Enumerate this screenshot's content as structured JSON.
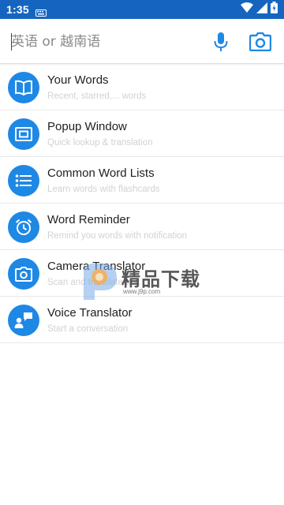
{
  "status": {
    "time": "1:35"
  },
  "search": {
    "placeholder": "英语 or 越南语"
  },
  "colors": {
    "accent": "#1e88e5",
    "statusbar": "#1565c0"
  },
  "menu": [
    {
      "icon": "book-icon",
      "title": "Your Words",
      "subtitle": "Recent, starred,... words"
    },
    {
      "icon": "popup-window-icon",
      "title": "Popup Window",
      "subtitle": "Quick lookup & translation"
    },
    {
      "icon": "list-icon",
      "title": "Common Word Lists",
      "subtitle": "Learn words with flashcards"
    },
    {
      "icon": "alarm-clock-icon",
      "title": "Word Reminder",
      "subtitle": "Remind you words with notification"
    },
    {
      "icon": "camera-icon",
      "title": "Camera Translator",
      "subtitle": "Scan and translate text"
    },
    {
      "icon": "voice-chat-icon",
      "title": "Voice Translator",
      "subtitle": "Start a conversation"
    }
  ],
  "watermark": {
    "text": "精品下载",
    "url": "www.j9p.com"
  }
}
